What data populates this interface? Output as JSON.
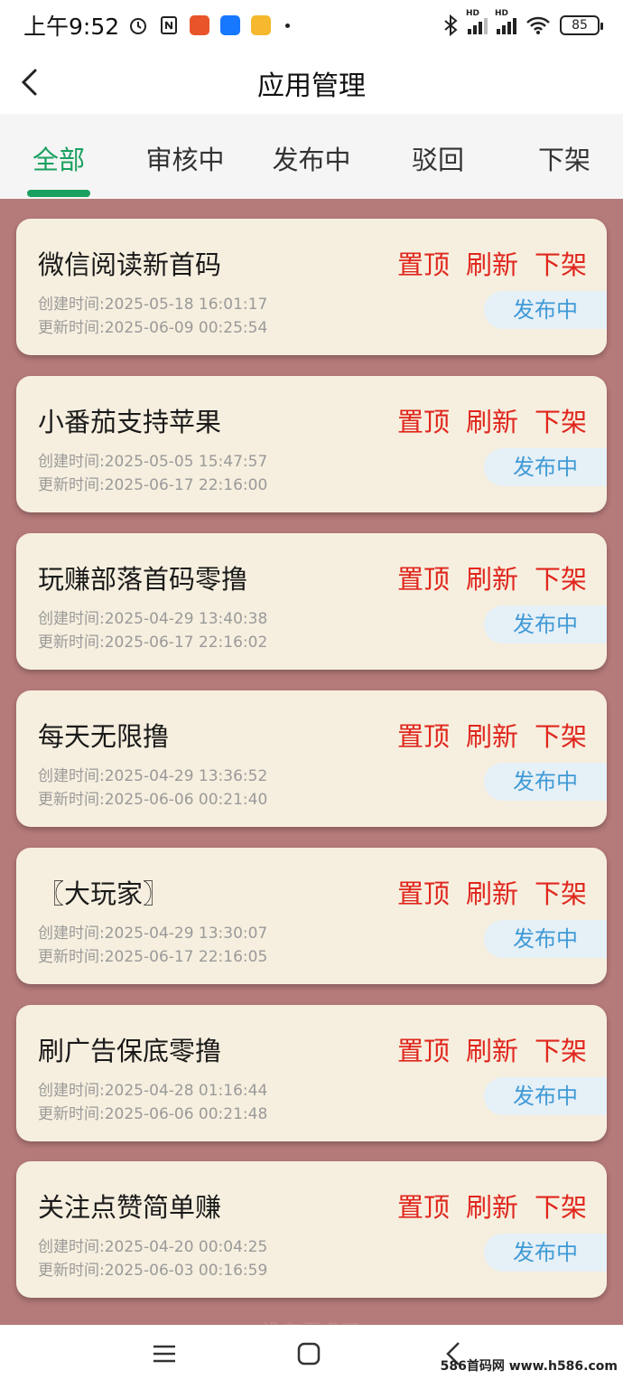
{
  "status_bar": {
    "time": "上午9:52",
    "battery": "85",
    "signal_label": "HD"
  },
  "header": {
    "title": "应用管理"
  },
  "tabs": [
    {
      "label": "全部",
      "active": true
    },
    {
      "label": "审核中"
    },
    {
      "label": "发布中"
    },
    {
      "label": "驳回"
    },
    {
      "label": "下架"
    }
  ],
  "actions": {
    "pin": "置顶",
    "refresh": "刷新",
    "unlist": "下架"
  },
  "apps": [
    {
      "name": "微信阅读新首码",
      "created": "创建时间:2025-05-18 16:01:17",
      "updated": "更新时间:2025-06-09 00:25:54",
      "status": "发布中"
    },
    {
      "name": "小番茄支持苹果",
      "created": "创建时间:2025-05-05 15:47:57",
      "updated": "更新时间:2025-06-17 22:16:00",
      "status": "发布中"
    },
    {
      "name": "玩赚部落首码零撸",
      "created": "创建时间:2025-04-29 13:40:38",
      "updated": "更新时间:2025-06-17 22:16:02",
      "status": "发布中"
    },
    {
      "name": "每天无限撸",
      "created": "创建时间:2025-04-29 13:36:52",
      "updated": "更新时间:2025-06-06 00:21:40",
      "status": "发布中"
    },
    {
      "name": "〖大玩家〗",
      "created": "创建时间:2025-04-29 13:30:07",
      "updated": "更新时间:2025-06-17 22:16:05",
      "status": "发布中"
    },
    {
      "name": "刷广告保底零撸",
      "created": "创建时间:2025-04-28 01:16:44",
      "updated": "更新时间:2025-06-06 00:21:48",
      "status": "发布中"
    },
    {
      "name": "关注点赞简单赚",
      "created": "创建时间:2025-04-20 00:04:25",
      "updated": "更新时间:2025-06-03 00:16:59",
      "status": "发布中"
    }
  ],
  "footer": {
    "more_hint": "没有更多了",
    "watermark": "586首码网 www.h586.com"
  },
  "colors": {
    "accent": "#1aa060",
    "action_red": "#e0261d",
    "status_blue": "#3f9ad6",
    "card_bg": "#f6efdf",
    "list_bg": "#b57a7a"
  }
}
